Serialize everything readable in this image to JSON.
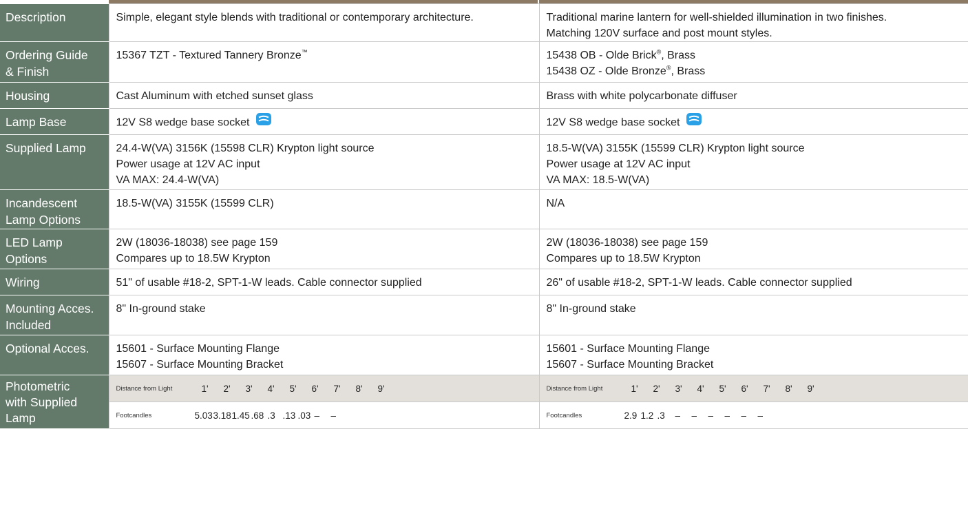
{
  "colors": {
    "label_bg": "#637a6a",
    "label_text": "#ffffff",
    "photometric_header_bg": "#e3e0dc",
    "top_rule": "#8c7a64",
    "icon_blue": "#2aa0e6"
  },
  "rows": {
    "description": {
      "label": "Description",
      "left": [
        "Simple, elegant style blends with traditional or contemporary architecture."
      ],
      "right": [
        "Traditional marine lantern for well-shielded illumination in two finishes.",
        "Matching 120V surface and post mount styles."
      ]
    },
    "ordering": {
      "label_lines": [
        "Ordering Guide",
        "& Finish"
      ],
      "left_text": "15367 TZT - Textured Tannery Bronze",
      "left_mark": "™",
      "right": [
        {
          "text": "15438 OB - Olde Brick",
          "mark": "®",
          "suffix": ", Brass"
        },
        {
          "text": "15438 OZ - Olde Bronze",
          "mark": "®",
          "suffix": ", Brass"
        }
      ]
    },
    "housing": {
      "label": "Housing",
      "left": "Cast Aluminum with etched sunset glass",
      "right": "Brass with white polycarbonate diffuser"
    },
    "lamp_base": {
      "label": "Lamp Base",
      "left": "12V  S8 wedge base socket",
      "right": "12V  S8 wedge base socket",
      "icon": "wedge-socket-icon"
    },
    "supplied_lamp": {
      "label": "Supplied Lamp",
      "left": [
        "24.4-W(VA) 3156K (15598 CLR) Krypton light source",
        "Power usage at 12V AC input",
        "VA MAX: 24.4-W(VA)"
      ],
      "right": [
        "18.5-W(VA) 3155K (15599 CLR) Krypton light source",
        "Power usage at 12V AC input",
        "VA MAX: 18.5-W(VA)"
      ]
    },
    "incandescent": {
      "label_lines": [
        "Incandescent",
        "Lamp Options"
      ],
      "left": "18.5-W(VA) 3155K (15599 CLR)",
      "right": "N/A"
    },
    "led": {
      "label_lines": [
        "LED Lamp",
        "Options"
      ],
      "left": [
        "2W (18036-18038) see page 159",
        "Compares up to 18.5W Krypton"
      ],
      "right": [
        "2W (18036-18038) see page 159",
        "Compares up to 18.5W Krypton"
      ]
    },
    "wiring": {
      "label": "Wiring",
      "left": "51\" of usable #18-2, SPT-1-W leads. Cable connector supplied",
      "right": "26\" of usable #18-2, SPT-1-W leads. Cable connector supplied"
    },
    "mounting": {
      "label_lines": [
        "Mounting Acces.",
        "Included"
      ],
      "left": "8\" In-ground stake",
      "right": "8\" In-ground stake"
    },
    "optional": {
      "label": "Optional Acces.",
      "left": [
        "15601 - Surface Mounting Flange",
        "15607 - Surface Mounting Bracket"
      ],
      "right": [
        "15601 - Surface Mounting Flange",
        "15607 - Surface Mounting Bracket"
      ]
    },
    "photometric": {
      "label_lines": [
        "Photometric",
        "with Supplied",
        "Lamp"
      ],
      "distance_label": "Distance from Light",
      "distances": [
        "1'",
        "2'",
        "3'",
        "4'",
        "5'",
        "6'",
        "7'",
        "8'",
        "9'"
      ],
      "footcandles_label": "Footcandles",
      "left_values": [
        "5.03",
        "3.18",
        "1.45",
        ".68",
        ".3",
        ".13",
        ".03",
        "–",
        "–"
      ],
      "right_values": [
        "2.9",
        "1.2",
        ".3",
        "–",
        "–",
        "–",
        "–",
        "–",
        "–"
      ]
    }
  }
}
